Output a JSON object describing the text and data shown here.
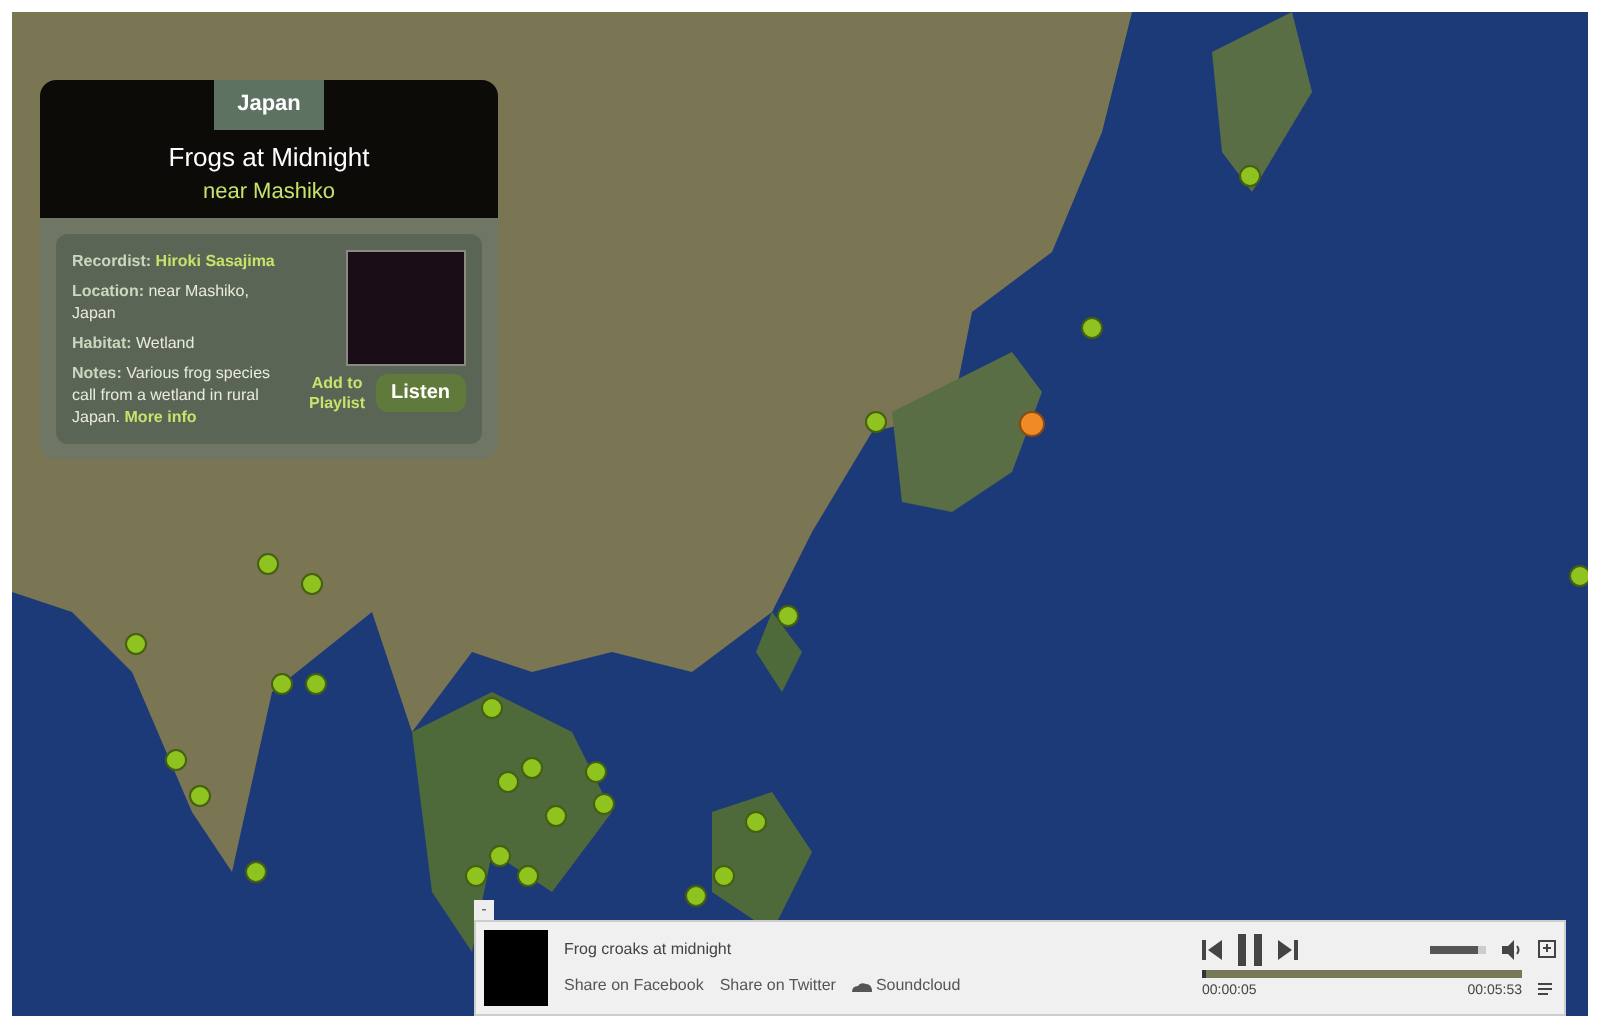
{
  "info_card": {
    "country": "Japan",
    "title": "Frogs at Midnight",
    "subtitle": "near Mashiko",
    "fields": [
      {
        "label": "Recordist:",
        "value": "Hiroki Sasajima",
        "kind": "link"
      },
      {
        "label": "Location:",
        "value": "near Mashiko, Japan",
        "kind": "text"
      },
      {
        "label": "Habitat:",
        "value": "Wetland",
        "kind": "text"
      },
      {
        "label": "Notes:",
        "value": "Various frog species call from a wetland in rural Japan.",
        "kind": "text",
        "link": "More info"
      }
    ],
    "add_to_playlist": "Add to Playlist",
    "listen": "Listen"
  },
  "player": {
    "collapse": "-",
    "track": "Frog croaks at midnight",
    "links": [
      "Share on Facebook",
      "Share on Twitter"
    ],
    "soundcloud": "Soundcloud",
    "playing": true,
    "volume": {
      "level": 0.85
    },
    "progress": {
      "level": 0.015
    },
    "elapsed": "00:00:05",
    "duration": "00:05:53"
  }
}
